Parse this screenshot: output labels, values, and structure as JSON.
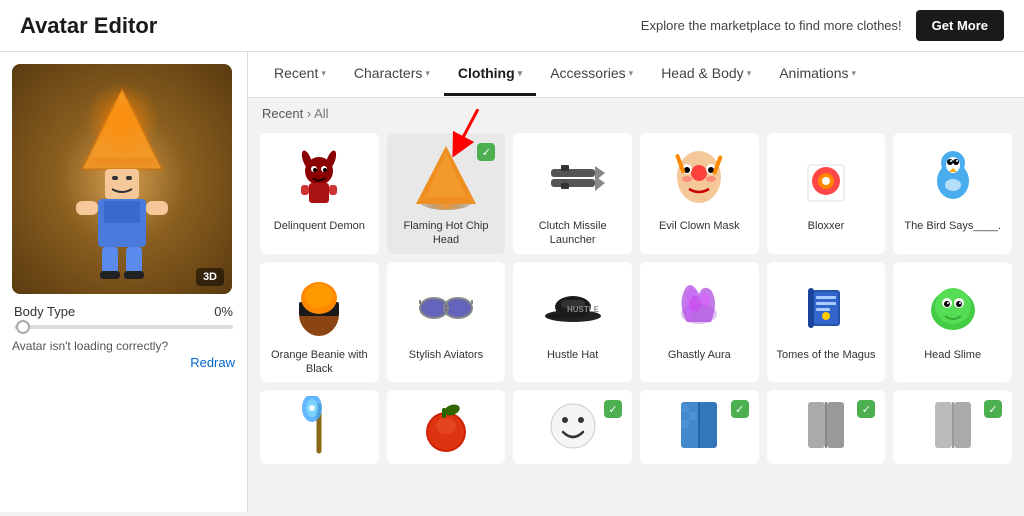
{
  "header": {
    "title": "Avatar Editor",
    "marketplace_text": "Explore the marketplace to find more clothes!",
    "get_more_label": "Get More"
  },
  "nav": {
    "tabs": [
      {
        "id": "recent",
        "label": "Recent",
        "active": false
      },
      {
        "id": "characters",
        "label": "Characters",
        "active": false
      },
      {
        "id": "clothing",
        "label": "Clothing",
        "active": true
      },
      {
        "id": "accessories",
        "label": "Accessories",
        "active": false
      },
      {
        "id": "head-body",
        "label": "Head & Body",
        "active": false
      },
      {
        "id": "animations",
        "label": "Animations",
        "active": false
      }
    ]
  },
  "breadcrumb": {
    "path": "Recent",
    "current": "All"
  },
  "left_panel": {
    "three_d_label": "3D",
    "body_type_label": "Body Type",
    "body_type_pct": "0%",
    "loading_warn": "Avatar isn't loading correctly?",
    "redraw_label": "Redraw"
  },
  "items": [
    {
      "id": "delinquent-demon",
      "label": "Delinquent Demon",
      "checked": false,
      "type": "demon"
    },
    {
      "id": "flaming-hot-chip",
      "label": "Flaming Hot Chip Head",
      "checked": true,
      "type": "chip"
    },
    {
      "id": "clutch-missile",
      "label": "Clutch Missile Launcher",
      "checked": false,
      "type": "missiles"
    },
    {
      "id": "evil-clown-mask",
      "label": "Evil Clown Mask",
      "checked": false,
      "type": "clown"
    },
    {
      "id": "bloxxer",
      "label": "Bloxxer",
      "checked": false,
      "type": "shirt-red"
    },
    {
      "id": "bird-says",
      "label": "The Bird Says____.",
      "checked": false,
      "type": "bird"
    },
    {
      "id": "orange-beanie",
      "label": "Orange Beanie with Black",
      "checked": false,
      "type": "beanie"
    },
    {
      "id": "stylish-aviators",
      "label": "Stylish Aviators",
      "checked": false,
      "type": "sunglasses"
    },
    {
      "id": "hustle-hat",
      "label": "Hustle Hat",
      "checked": false,
      "type": "cap"
    },
    {
      "id": "ghastly-aura",
      "label": "Ghastly Aura",
      "checked": false,
      "type": "aura"
    },
    {
      "id": "tomes-magus",
      "label": "Tomes of the Magus",
      "checked": false,
      "type": "book"
    },
    {
      "id": "head-slime",
      "label": "Head Slime",
      "checked": false,
      "type": "slime"
    },
    {
      "id": "item-r3-1",
      "label": "",
      "checked": false,
      "type": "staff"
    },
    {
      "id": "item-r3-2",
      "label": "",
      "checked": false,
      "type": "tomato"
    },
    {
      "id": "item-r3-3",
      "label": "",
      "checked": true,
      "type": "face"
    },
    {
      "id": "item-r3-4",
      "label": "",
      "checked": true,
      "type": "pants-blue"
    },
    {
      "id": "item-r3-5",
      "label": "",
      "checked": true,
      "type": "pants-gray"
    },
    {
      "id": "item-r3-6",
      "label": "",
      "checked": true,
      "type": "pants-gray2"
    }
  ]
}
